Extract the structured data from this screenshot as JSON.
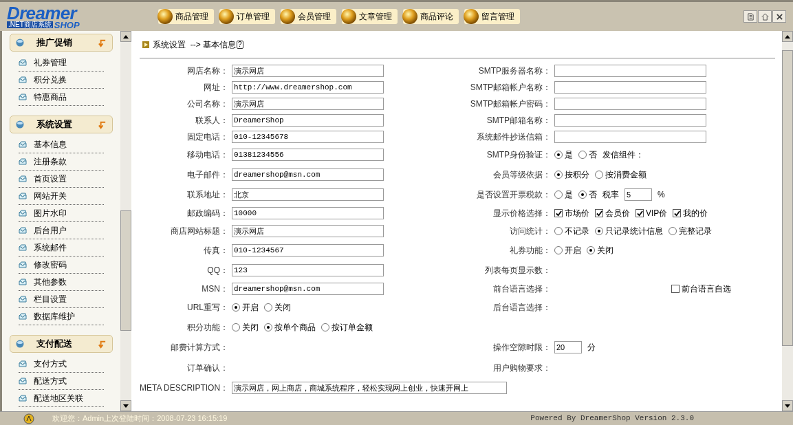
{
  "logo": {
    "name": "Dreamer",
    "subtitle": ".NET商店系统",
    "suffix": "SHOP"
  },
  "nav": [
    {
      "label": "商品管理"
    },
    {
      "label": "订单管理"
    },
    {
      "label": "会员管理"
    },
    {
      "label": "文章管理"
    },
    {
      "label": "商品评论"
    },
    {
      "label": "留言管理"
    }
  ],
  "sidebar": [
    {
      "title": "推广促销",
      "items": [
        "礼券管理",
        "积分兑换",
        "特惠商品"
      ]
    },
    {
      "title": "系统设置",
      "items": [
        "基本信息",
        "注册条款",
        "首页设置",
        "网站开关",
        "图片水印",
        "后台用户",
        "系统邮件",
        "修改密码",
        "其他参数",
        "栏目设置",
        "数据库维护"
      ]
    },
    {
      "title": "支付配送",
      "items": [
        "支付方式",
        "配送方式",
        "配送地区关联"
      ]
    }
  ],
  "breadcrumb": {
    "path": "系统设置",
    "arrow": "-->",
    "current": "基本信息",
    "help": "?"
  },
  "rows": [
    {
      "left": {
        "label": "网店名称：",
        "controls": [
          {
            "kind": "input",
            "value": "演示网店"
          }
        ]
      },
      "right": {
        "label": "SMTP服务器名称：",
        "controls": [
          {
            "kind": "input"
          }
        ]
      }
    },
    {
      "left": {
        "label": "网址：",
        "controls": [
          {
            "kind": "input",
            "value": "http://www.dreamershop.com"
          }
        ]
      },
      "right": {
        "label": "SMTP邮箱帐户名称：",
        "controls": [
          {
            "kind": "input"
          }
        ]
      }
    },
    {
      "left": {
        "label": "公司名称：",
        "controls": [
          {
            "kind": "input",
            "value": "演示网店"
          }
        ]
      },
      "right": {
        "label": "SMTP邮箱帐户密码：",
        "controls": [
          {
            "kind": "input"
          }
        ]
      }
    },
    {
      "left": {
        "label": "联系人：",
        "controls": [
          {
            "kind": "input",
            "value": "DreamerShop"
          }
        ]
      },
      "right": {
        "label": "SMTP邮箱名称：",
        "controls": [
          {
            "kind": "input"
          }
        ]
      }
    },
    {
      "left": {
        "label": "固定电话：",
        "controls": [
          {
            "kind": "input",
            "value": "010-12345678"
          }
        ]
      },
      "right": {
        "label": "系统邮件抄送信箱：",
        "controls": [
          {
            "kind": "input"
          }
        ]
      }
    },
    {
      "left": {
        "label": "移动电话：",
        "controls": [
          {
            "kind": "input",
            "value": "01381234556"
          }
        ]
      },
      "right": {
        "label": "SMTP身份验证：",
        "controls": [
          {
            "kind": "radio",
            "label": "是",
            "selected": true
          },
          {
            "kind": "radio",
            "label": "否",
            "selected": false
          },
          {
            "kind": "text",
            "text": "发信组件："
          }
        ]
      }
    },
    {
      "left": {
        "label": "电子邮件：",
        "controls": [
          {
            "kind": "input",
            "value": "dreamershop@msn.com"
          }
        ]
      },
      "right": {
        "label": "会员等级依据：",
        "controls": [
          {
            "kind": "radio",
            "label": "按积分",
            "selected": true
          },
          {
            "kind": "radio",
            "label": "按消费金额",
            "selected": false
          }
        ]
      }
    },
    {
      "left": {
        "label": "联系地址：",
        "controls": [
          {
            "kind": "input",
            "value": "北京"
          }
        ]
      },
      "right": {
        "label": "是否设置开票税款：",
        "controls": [
          {
            "kind": "radio",
            "label": "是",
            "selected": false
          },
          {
            "kind": "radio",
            "label": "否",
            "selected": true
          },
          {
            "kind": "text",
            "text": "税率"
          },
          {
            "kind": "short_input",
            "value": "5"
          },
          {
            "kind": "text",
            "text": "%"
          }
        ]
      }
    },
    {
      "left": {
        "label": "邮政编码：",
        "controls": [
          {
            "kind": "input",
            "value": "10000"
          }
        ]
      },
      "right": {
        "label": "显示价格选择：",
        "controls": [
          {
            "kind": "checkbox",
            "label": "市场价",
            "checked": true
          },
          {
            "kind": "checkbox",
            "label": "会员价",
            "checked": true
          },
          {
            "kind": "checkbox",
            "label": "VIP价",
            "checked": true
          },
          {
            "kind": "checkbox",
            "label": "我的价",
            "checked": true
          }
        ]
      }
    },
    {
      "left": {
        "label": "商店网站标题：",
        "controls": [
          {
            "kind": "input",
            "value": "演示网店"
          }
        ]
      },
      "right": {
        "label": "访问统计：",
        "controls": [
          {
            "kind": "radio",
            "label": "不记录",
            "selected": false
          },
          {
            "kind": "radio",
            "label": "只记录统计信息",
            "selected": true
          },
          {
            "kind": "radio",
            "label": "完整记录",
            "selected": false
          }
        ]
      }
    },
    {
      "left": {
        "label": "传真：",
        "controls": [
          {
            "kind": "input",
            "value": "010-1234567"
          }
        ]
      },
      "right": {
        "label": "礼券功能：",
        "controls": [
          {
            "kind": "radio",
            "label": "开启",
            "selected": false
          },
          {
            "kind": "radio",
            "label": "关闭",
            "selected": true
          }
        ]
      }
    },
    {
      "left": {
        "label": "QQ：",
        "controls": [
          {
            "kind": "input",
            "value": "123"
          }
        ]
      },
      "right": {
        "label": "列表每页显示数："
      }
    },
    {
      "left": {
        "label": "MSN：",
        "controls": [
          {
            "kind": "input",
            "value": "dreamershop@msn.com"
          }
        ]
      },
      "right": {
        "label": "前台语言选择：",
        "controls": [
          {
            "kind": "aside_checkbox",
            "label": "前台语言自选",
            "checked": false
          }
        ]
      }
    },
    {
      "left": {
        "label": "URL重写：",
        "controls": [
          {
            "kind": "radio",
            "label": "开启",
            "selected": true
          },
          {
            "kind": "radio",
            "label": "关闭",
            "selected": false
          }
        ]
      },
      "right": {
        "label": "后台语言选择："
      }
    },
    {
      "left": {
        "label": "积分功能：",
        "controls": [
          {
            "kind": "radio",
            "label": "关闭",
            "selected": false
          },
          {
            "kind": "radio",
            "label": "按单个商品",
            "selected": true
          },
          {
            "kind": "radio",
            "label": "按订单金额",
            "selected": false
          }
        ]
      }
    },
    {
      "left": {
        "label": "邮费计算方式："
      },
      "right": {
        "label": "操作空隙时限：",
        "controls": [
          {
            "kind": "short_input",
            "value": "20"
          },
          {
            "kind": "text",
            "text": "分"
          }
        ]
      }
    },
    {
      "left": {
        "label": "订单确认："
      },
      "right": {
        "label": "用户购物要求："
      }
    },
    {
      "left": {
        "label": "META DESCRIPTION：",
        "controls": [
          {
            "kind": "long_input",
            "value": "演示网店，网上商店，商城系统程序，轻松实现网上创业，快速开网上"
          }
        ]
      }
    }
  ],
  "status": {
    "welcome": "欢迎您：Admin上次登陆时间：2008-07-23 16:15:19",
    "powered": "Powered By DreamerShop Version 2.3.0"
  }
}
